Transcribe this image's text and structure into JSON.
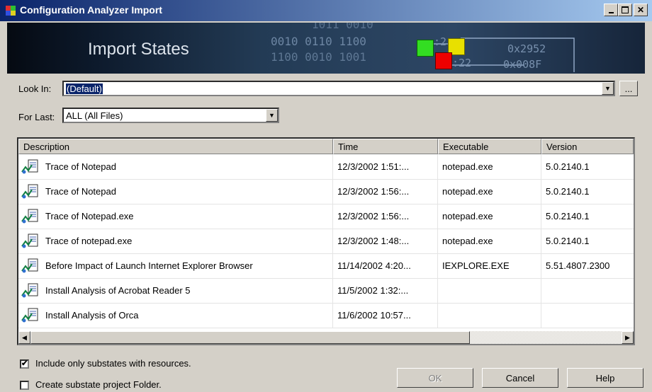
{
  "window": {
    "title": "Configuration Analyzer Import"
  },
  "banner": {
    "title": "Import States",
    "bits_line1": "0010 0110 1100",
    "bits_line2": "1100 0010 1001",
    "bits_top": "1011 0010",
    "hex1": "0x2952",
    "hex2": "0x008F",
    "colon1": ":2",
    "colon2": ":22"
  },
  "look_in": {
    "label": "Look In:",
    "value": "(Default)",
    "browse_label": "..."
  },
  "for_last": {
    "label": "For Last:",
    "value": "ALL (All Files)"
  },
  "table": {
    "columns": [
      "Description",
      "Time",
      "Executable",
      "Version"
    ],
    "rows": [
      {
        "description": "Trace of Notepad",
        "time": "12/3/2002 1:51:...",
        "executable": "notepad.exe",
        "version": "5.0.2140.1"
      },
      {
        "description": "Trace of Notepad",
        "time": "12/3/2002 1:56:...",
        "executable": "notepad.exe",
        "version": "5.0.2140.1"
      },
      {
        "description": "Trace of Notepad.exe",
        "time": "12/3/2002 1:56:...",
        "executable": "notepad.exe",
        "version": "5.0.2140.1"
      },
      {
        "description": "Trace of notepad.exe",
        "time": "12/3/2002 1:48:...",
        "executable": "notepad.exe",
        "version": "5.0.2140.1"
      },
      {
        "description": "Before Impact of Launch Internet Explorer Browser",
        "time": "11/14/2002 4:20...",
        "executable": "IEXPLORE.EXE",
        "version": "5.51.4807.2300"
      },
      {
        "description": "Install Analysis of Acrobat Reader 5",
        "time": "11/5/2002 1:32:...",
        "executable": "",
        "version": ""
      },
      {
        "description": "Install Analysis of Orca",
        "time": "11/6/2002 10:57...",
        "executable": "",
        "version": ""
      }
    ]
  },
  "options": {
    "include_only": {
      "label": "Include only substates with resources.",
      "checked": true
    },
    "create_folder": {
      "label": "Create substate project Folder.",
      "checked": false
    }
  },
  "buttons": {
    "ok": "OK",
    "cancel": "Cancel",
    "help": "Help"
  },
  "colors": {
    "titlebar_start": "#0a246a",
    "titlebar_end": "#a6caf0",
    "dialog_bg": "#d4d0c8",
    "selection": "#0a246a"
  }
}
